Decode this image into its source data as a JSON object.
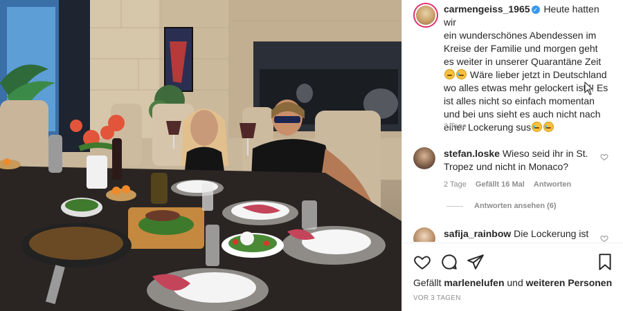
{
  "post": {
    "username": "carmengeiss_1965",
    "caption_lines": [
      "Heute hatten wir",
      "ein wunderschönes Abendessen im",
      "Kreise der Familie und morgen geht",
      "es weiter in unserer Quarantäne Zeit",
      "Wäre lieber jetzt in Deutschland",
      "wo alles etwas mehr gelockert ist.!! Es",
      "ist alles nicht so einfach momentan",
      "und bei uns sieht es auch nicht nach",
      "einer Lockerung sus"
    ],
    "time_ago": "3 Tage"
  },
  "comments": [
    {
      "username": "stefan.loske",
      "text": "Wieso seid ihr in St. Tropez und nicht in Monaco?",
      "time": "2 Tage",
      "likes": "Gefällt 16 Mal",
      "reply": "Antworten",
      "view_replies": "Antworten ansehen (6)"
    },
    {
      "username": "safija_rainbow",
      "text": "Die Lockerung ist"
    }
  ],
  "footer": {
    "likes_prefix": "Gefällt",
    "likes_user": "marlenelufen",
    "likes_middle": "und",
    "likes_rest": "weiteren Personen",
    "timestamp": "VOR 3 TAGEN"
  },
  "icons": {
    "like": "heart-icon",
    "comment": "comment-icon",
    "share": "send-icon",
    "save": "bookmark-icon",
    "verified": "verified-badge-icon"
  },
  "colors": {
    "accent": "#3897f0",
    "story_ring": "#e1306c",
    "muted": "#8e8e8e"
  }
}
